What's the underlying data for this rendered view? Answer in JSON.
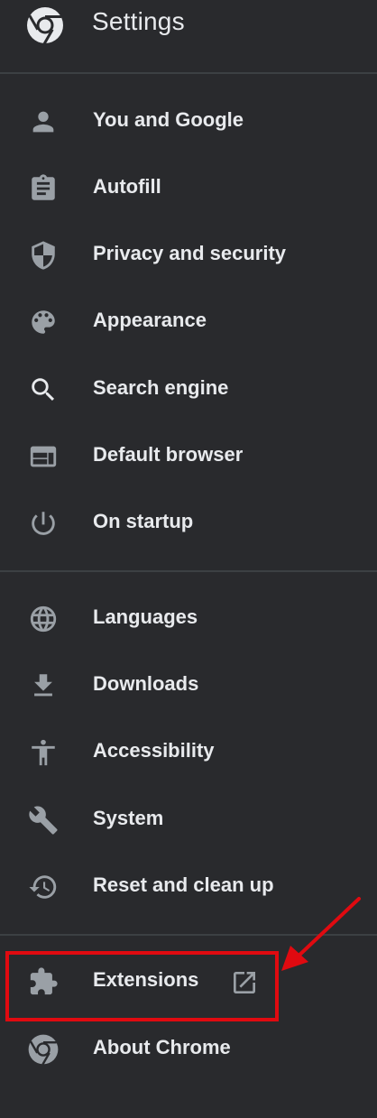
{
  "header": {
    "title": "Settings",
    "logo_icon": "chrome-logo-icon"
  },
  "colors": {
    "background": "#292a2d",
    "text": "#e8eaed",
    "icon": "#9aa0a6",
    "divider": "#3c4043",
    "annotation": "#e00a10"
  },
  "nav": {
    "group1": [
      {
        "label": "You and Google",
        "icon": "person-icon"
      },
      {
        "label": "Autofill",
        "icon": "clipboard-icon"
      },
      {
        "label": "Privacy and security",
        "icon": "shield-icon"
      },
      {
        "label": "Appearance",
        "icon": "palette-icon"
      },
      {
        "label": "Search engine",
        "icon": "search-icon"
      },
      {
        "label": "Default browser",
        "icon": "browser-window-icon"
      },
      {
        "label": "On startup",
        "icon": "power-icon"
      }
    ],
    "group2": [
      {
        "label": "Languages",
        "icon": "globe-icon"
      },
      {
        "label": "Downloads",
        "icon": "download-icon"
      },
      {
        "label": "Accessibility",
        "icon": "accessibility-icon"
      },
      {
        "label": "System",
        "icon": "wrench-icon"
      },
      {
        "label": "Reset and clean up",
        "icon": "restore-icon"
      }
    ],
    "group3": [
      {
        "label": "Extensions",
        "icon": "puzzle-icon",
        "trailing_icon": "open-in-new-icon"
      },
      {
        "label": "About Chrome",
        "icon": "chrome-logo-icon"
      }
    ]
  }
}
